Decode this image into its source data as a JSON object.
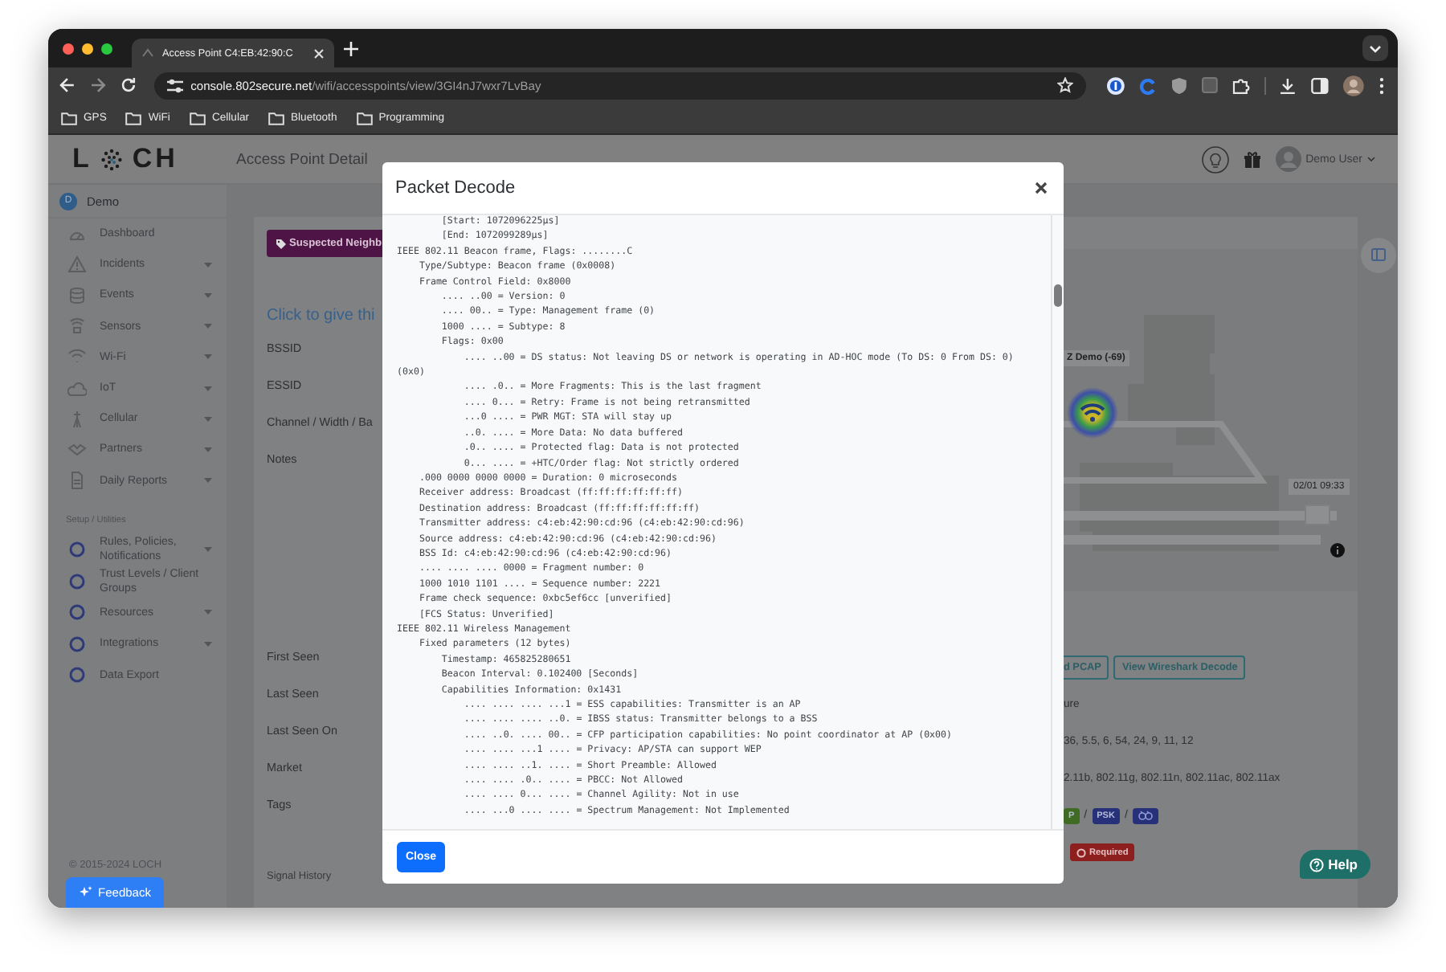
{
  "browser": {
    "tab_title": "Access Point C4:EB:42:90:C",
    "url_host": "console.802secure.net",
    "url_path": "/wifi/accesspoints/view/3GI4nJ7wxr7LvBay",
    "bookmarks": [
      "GPS",
      "WiFi",
      "Cellular",
      "Bluetooth",
      "Programming"
    ]
  },
  "app": {
    "logo_start": "L",
    "logo_end": "CH",
    "page_title": "Access Point Detail",
    "user": "Demo User"
  },
  "sidebar": {
    "org_initial": "D",
    "org_name": "Demo",
    "items": [
      {
        "label": "Dashboard",
        "has_submenu": false
      },
      {
        "label": "Incidents",
        "has_submenu": true
      },
      {
        "label": "Events",
        "has_submenu": true
      },
      {
        "label": "Sensors",
        "has_submenu": true
      },
      {
        "label": "Wi-Fi",
        "has_submenu": true
      },
      {
        "label": "IoT",
        "has_submenu": true
      },
      {
        "label": "Cellular",
        "has_submenu": true
      },
      {
        "label": "Partners",
        "has_submenu": true
      },
      {
        "label": "Daily Reports",
        "has_submenu": true
      }
    ],
    "section": "Setup / Utilities",
    "setup_items": [
      {
        "label": "Rules, Policies, Notifications",
        "has_submenu": true
      },
      {
        "label": "Trust Levels / Client Groups",
        "has_submenu": false
      },
      {
        "label": "Resources",
        "has_submenu": true
      },
      {
        "label": "Integrations",
        "has_submenu": true
      },
      {
        "label": "Data Export",
        "has_submenu": false
      }
    ],
    "copyright": "© 2015-2024 LOCH",
    "feedback": "Feedback"
  },
  "detail": {
    "category": "Suspected Neighb",
    "name_prompt": "Click to give thi",
    "top_labels": [
      "BSSID",
      "ESSID",
      "Channel / Width / Ba",
      "Notes"
    ],
    "bottom_labels": [
      "First Seen",
      "Last Seen",
      "Last Seen On",
      "Market",
      "Tags"
    ],
    "signal_history": "Signal History",
    "map": {
      "ap_label": "Z Demo (-69)",
      "timestamp": "02/01 09:33",
      "time_slider": {
        "level": 0.95
      }
    },
    "buttons": [
      "d PCAP",
      "View Wireshark Decode"
    ],
    "values": [
      "ure",
      "36, 5.5, 6, 54, 24, 9, 11, 12",
      "2.11b, 802.11g, 802.11n, 802.11ac, 802.11ax"
    ],
    "tags": [
      {
        "kind": "badge",
        "text": "P",
        "color": "#3f6b22"
      },
      {
        "kind": "separator",
        "text": "/"
      },
      {
        "kind": "badge",
        "text": "PSK",
        "color": "#26317a"
      },
      {
        "kind": "separator",
        "text": "/"
      },
      {
        "kind": "icon",
        "color": "#26317a"
      }
    ],
    "required": "Required"
  },
  "modal": {
    "title": "Packet Decode",
    "close": "Close",
    "lines": [
      "        [Start: 1072096225µs]",
      "        [End: 1072099289µs]",
      "IEEE 802.11 Beacon frame, Flags: ........C",
      "    Type/Subtype: Beacon frame (0x0008)",
      "    Frame Control Field: 0x8000",
      "        .... ..00 = Version: 0",
      "        .... 00.. = Type: Management frame (0)",
      "        1000 .... = Subtype: 8",
      "        Flags: 0x00",
      "            .... ..00 = DS status: Not leaving DS or network is operating in AD-HOC mode (To DS: 0 From DS: 0) (0x0)",
      "            .... .0.. = More Fragments: This is the last fragment",
      "            .... 0... = Retry: Frame is not being retransmitted",
      "            ...0 .... = PWR MGT: STA will stay up",
      "            ..0. .... = More Data: No data buffered",
      "            .0.. .... = Protected flag: Data is not protected",
      "            0... .... = +HTC/Order flag: Not strictly ordered",
      "    .000 0000 0000 0000 = Duration: 0 microseconds",
      "    Receiver address: Broadcast (ff:ff:ff:ff:ff:ff)",
      "    Destination address: Broadcast (ff:ff:ff:ff:ff:ff)",
      "    Transmitter address: c4:eb:42:90:cd:96 (c4:eb:42:90:cd:96)",
      "    Source address: c4:eb:42:90:cd:96 (c4:eb:42:90:cd:96)",
      "    BSS Id: c4:eb:42:90:cd:96 (c4:eb:42:90:cd:96)",
      "    .... .... .... 0000 = Fragment number: 0",
      "    1000 1010 1101 .... = Sequence number: 2221",
      "    Frame check sequence: 0xbc5ef6cc [unverified]",
      "    [FCS Status: Unverified]",
      "IEEE 802.11 Wireless Management",
      "    Fixed parameters (12 bytes)",
      "        Timestamp: 465825280651",
      "        Beacon Interval: 0.102400 [Seconds]",
      "        Capabilities Information: 0x1431",
      "            .... .... .... ...1 = ESS capabilities: Transmitter is an AP",
      "            .... .... .... ..0. = IBSS status: Transmitter belongs to a BSS",
      "            .... ..0. .... 00.. = CFP participation capabilities: No point coordinator at AP (0x00)",
      "            .... .... ...1 .... = Privacy: AP/STA can support WEP",
      "            .... .... ..1. .... = Short Preamble: Allowed",
      "            .... .... .0.. .... = PBCC: Not Allowed",
      "            .... .... 0... .... = Channel Agility: Not in use",
      "            .... ...0 .... .... = Spectrum Management: Not Implemented"
    ]
  },
  "help": "Help"
}
